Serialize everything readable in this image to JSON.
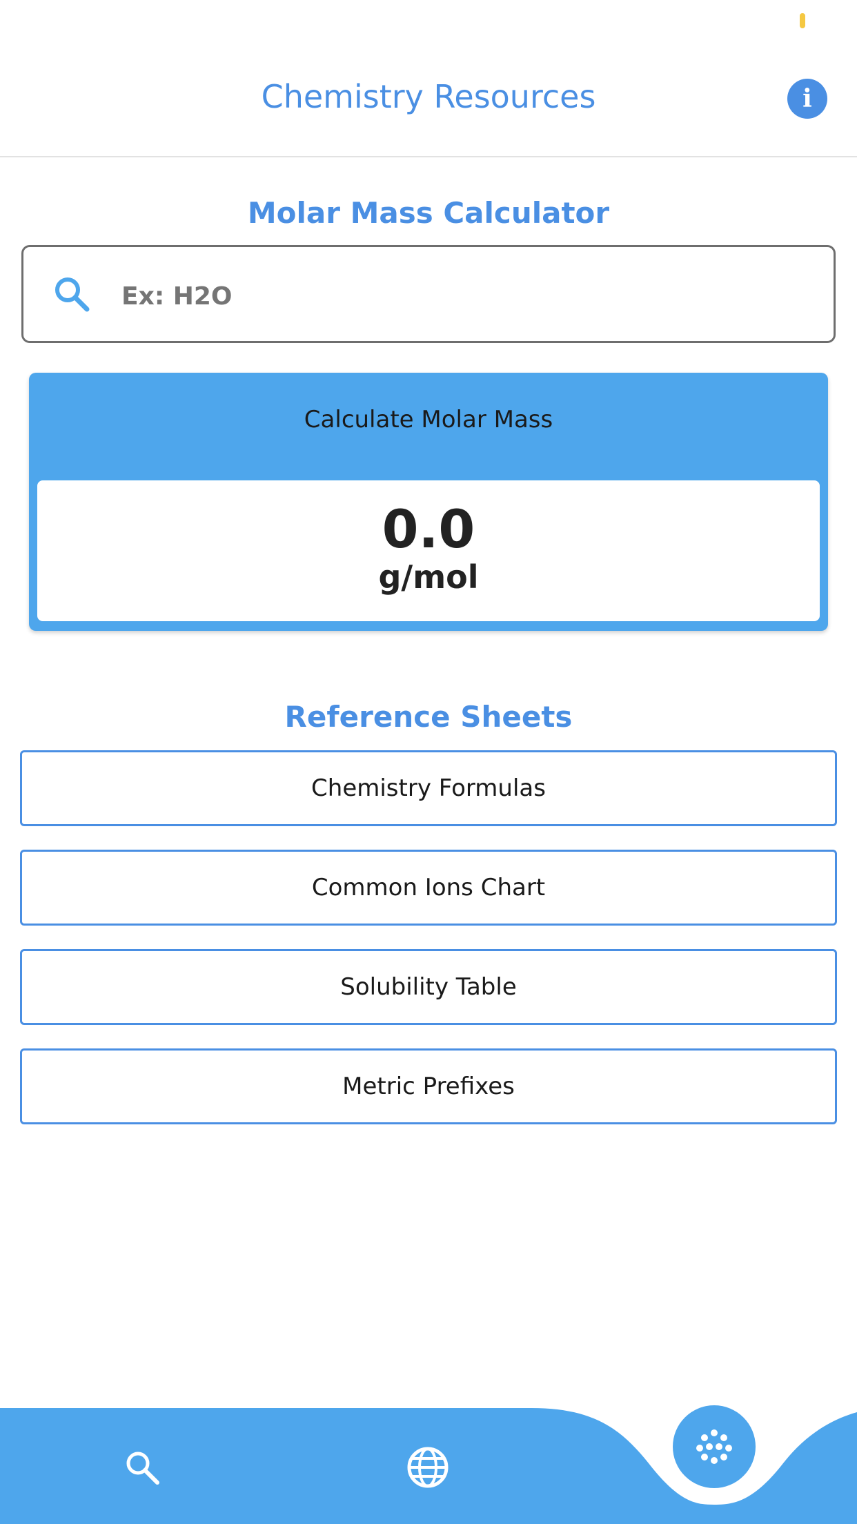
{
  "header": {
    "title": "Chemistry Resources",
    "info_icon": "info-icon",
    "info_glyph": "i"
  },
  "calculator": {
    "section_title": "Molar Mass Calculator",
    "search_icon": "search-icon",
    "input_placeholder": "Ex: H2O",
    "input_value": "",
    "calculate_label": "Calculate Molar Mass",
    "result_value": "0.0",
    "result_unit": "g/mol"
  },
  "reference": {
    "section_title": "Reference Sheets",
    "items": [
      {
        "label": "Chemistry Formulas"
      },
      {
        "label": "Common Ions Chart"
      },
      {
        "label": "Solubility Table"
      },
      {
        "label": "Metric Prefixes"
      }
    ]
  },
  "bottom_nav": {
    "items": [
      {
        "icon": "search-icon",
        "active": false
      },
      {
        "icon": "globe-icon",
        "active": false
      },
      {
        "icon": "molecule-icon",
        "active": true
      }
    ]
  },
  "colors": {
    "accent": "#4a8fe3",
    "card": "#4ea6ec",
    "nav": "#4ea6ec",
    "status_dot": "#f5c842"
  }
}
